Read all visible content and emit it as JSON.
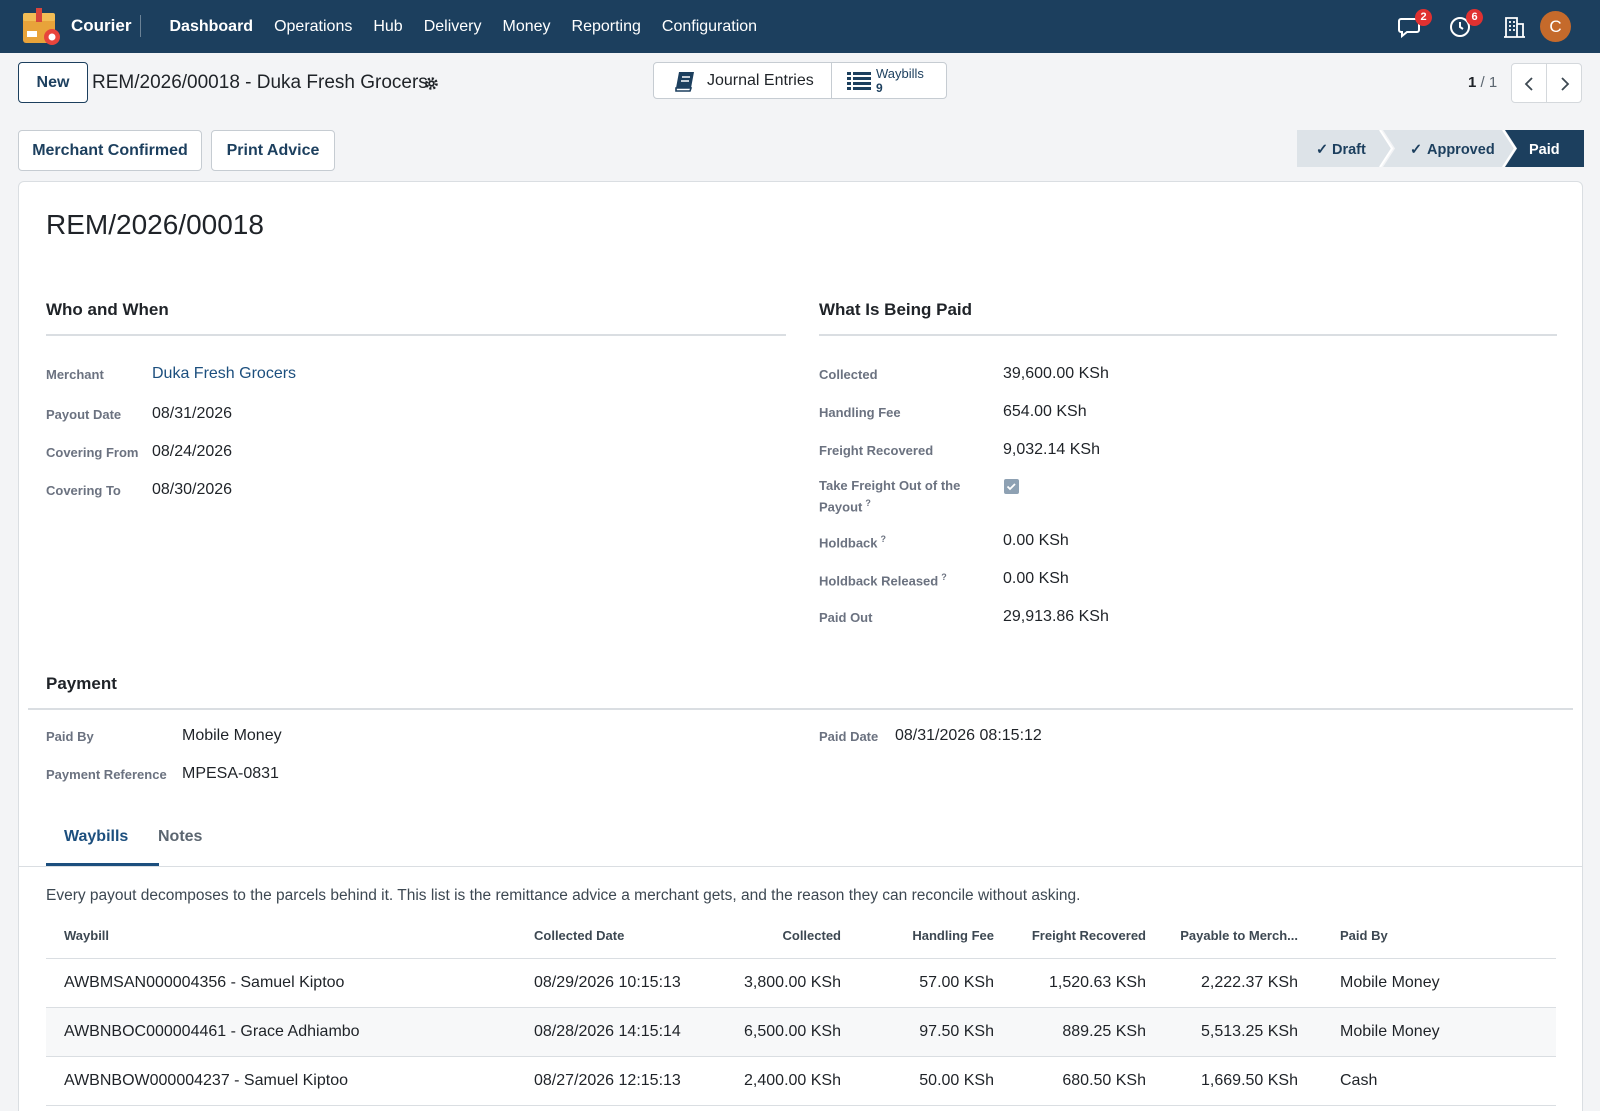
{
  "app": {
    "name": "Courier"
  },
  "menu": [
    "Dashboard",
    "Operations",
    "Hub",
    "Delivery",
    "Money",
    "Reporting",
    "Configuration"
  ],
  "systray": {
    "messages_count": "2",
    "activities_count": "6",
    "avatar_letter": "C"
  },
  "control": {
    "new_label": "New",
    "record_title": "REM/2026/00018 - Duka Fresh Grocers",
    "journal_label": "Journal Entries",
    "waybills_label": "Waybills",
    "waybills_count": "9",
    "pager_current": "1",
    "pager_total": "/ 1"
  },
  "actions": {
    "merchant_confirmed": "Merchant Confirmed",
    "print_advice": "Print Advice"
  },
  "status": {
    "stages": [
      "Draft",
      "Approved",
      "Paid"
    ],
    "check": "✓",
    "current": "Paid"
  },
  "record": {
    "name": "REM/2026/00018",
    "who_title": "Who and When",
    "what_title": "What Is Being Paid",
    "merchant_label": "Merchant",
    "merchant": "Duka Fresh Grocers",
    "payout_date_label": "Payout Date",
    "payout_date": "08/31/2026",
    "covering_from_label": "Covering From",
    "covering_from": "08/24/2026",
    "covering_to_label": "Covering To",
    "covering_to": "08/30/2026",
    "collected_label": "Collected",
    "collected": "39,600.00 KSh",
    "handling_fee_label": "Handling Fee",
    "handling_fee": "654.00 KSh",
    "freight_recovered_label": "Freight Recovered",
    "freight_recovered": "9,032.14 KSh",
    "take_freight_label_1": "Take Freight Out of the",
    "take_freight_label_2": "Payout",
    "take_freight": true,
    "holdback_label": "Holdback",
    "holdback": "0.00 KSh",
    "holdback_released_label": "Holdback Released",
    "holdback_released": "0.00 KSh",
    "paid_out_label": "Paid Out",
    "paid_out": "29,913.86 KSh",
    "help_mark": "?"
  },
  "payment": {
    "title": "Payment",
    "paid_by_label": "Paid By",
    "paid_by": "Mobile Money",
    "paid_date_label": "Paid Date",
    "paid_date": "08/31/2026 08:15:12",
    "reference_label": "Payment Reference",
    "reference": "MPESA-0831"
  },
  "tabs": {
    "waybills": "Waybills",
    "notes": "Notes"
  },
  "waybills": {
    "note": "Every payout decomposes to the parcels behind it. This list is the remittance advice a merchant gets, and the reason they can reconcile without asking.",
    "columns": [
      "Waybill",
      "Collected Date",
      "Collected",
      "Handling Fee",
      "Freight Recovered",
      "Payable to Merch...",
      "Paid By"
    ],
    "rows": [
      [
        "AWBMSAN000004356 - Samuel Kiptoo",
        "08/29/2026 10:15:13",
        "3,800.00 KSh",
        "57.00 KSh",
        "1,520.63 KSh",
        "2,222.37 KSh",
        "Mobile Money"
      ],
      [
        "AWBNBOC000004461 - Grace Adhiambo",
        "08/28/2026 14:15:14",
        "6,500.00 KSh",
        "97.50 KSh",
        "889.25 KSh",
        "5,513.25 KSh",
        "Mobile Money"
      ],
      [
        "AWBNBOW000004237 - Samuel Kiptoo",
        "08/27/2026 12:15:13",
        "2,400.00 KSh",
        "50.00 KSh",
        "680.50 KSh",
        "1,669.50 KSh",
        "Cash"
      ]
    ]
  },
  "colors": {
    "navbar": "#1c3f5e",
    "accent": "#1c4f7e",
    "status_active": "#1c3f5e",
    "status_inactive": "#dde3e8"
  }
}
